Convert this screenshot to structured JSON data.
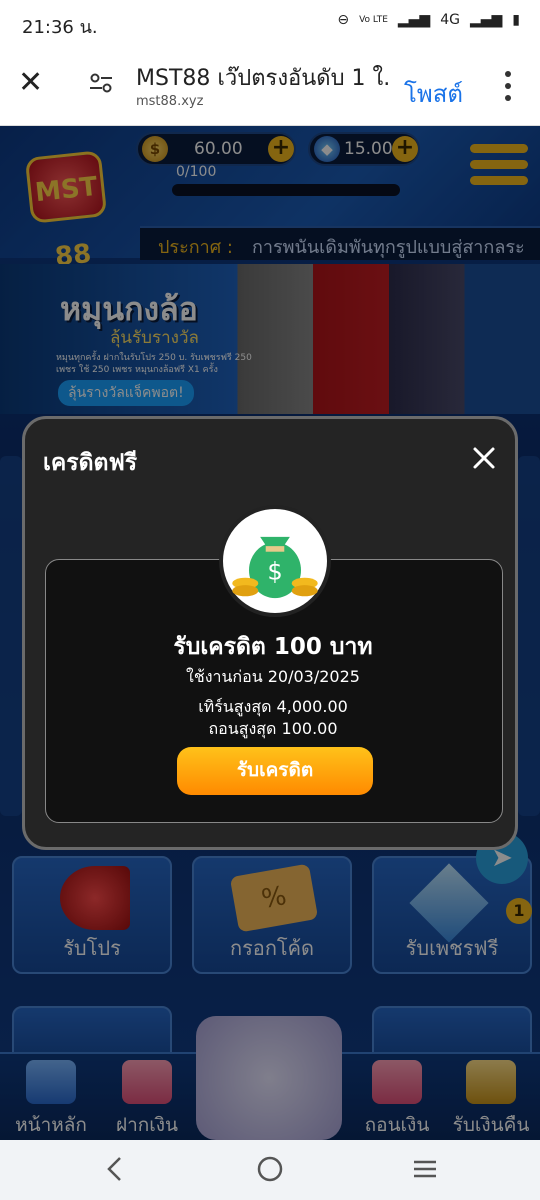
{
  "status": {
    "time": "21:36 น.",
    "network": "4G",
    "volte": "Vo LTE"
  },
  "browser": {
    "title": "MST88 เว๊ปตรงอันดับ 1 ใ...",
    "domain": "mst88.xyz",
    "post_label": "โพสต์"
  },
  "header": {
    "logo_text": "MST 88",
    "coins": "60.00",
    "diamonds": "15.00",
    "level_progress": "0/100"
  },
  "announcement": {
    "label": "ประกาศ :",
    "text": "การพนันเดิมพันทุกรูปแบบสู่สากลระ"
  },
  "banner": {
    "headline": "หมุนกงล้อ",
    "subline": "ลุ้นรับรางวัล",
    "detail": "หมุนทุกครั้ง ฝากในรับโปร 250 บ. รับเพชรฟรี 250 เพชร ใช้ 250 เพชร หมุนกงล้อฟรี X1 ครั้ง",
    "cta": "ลุ้นรางวัลแจ็คพอต!"
  },
  "tiles": [
    {
      "label": "รับโปร"
    },
    {
      "label": "กรอกโค้ด"
    },
    {
      "label": "รับเพชรฟรี"
    }
  ],
  "badge_count": "1",
  "bottom_nav": [
    {
      "label": "หน้าหลัก"
    },
    {
      "label": "ฝากเงิน"
    },
    {
      "label": "ถอนเงิน"
    },
    {
      "label": "รับเงินคืน"
    }
  ],
  "modal": {
    "title": "เครดิตฟรี",
    "credit_title": "รับเครดิต 100 บาท",
    "use_before": "ใช้งานก่อน 20/03/2025",
    "max_turn": "เทิร์นสูงสุด 4,000.00",
    "max_withdraw": "ถอนสูงสุด 100.00",
    "claim_label": "รับเครดิต"
  },
  "colors": {
    "accent": "#f2b91e",
    "claim_gradient_top": "#ffc21a",
    "claim_gradient_bottom": "#ff8a00",
    "link": "#1a73e8"
  },
  "icons": [
    "close-icon",
    "tune-icon",
    "more-vert-icon",
    "coin-icon",
    "diamond-icon",
    "plus-icon",
    "hamburger-menu-icon",
    "money-bag-icon",
    "megaphone-icon",
    "ticket-icon",
    "crystal-icon",
    "home-icon",
    "piggy-bank-icon",
    "gamepad-icon",
    "cashback-icon",
    "telegram-icon"
  ]
}
